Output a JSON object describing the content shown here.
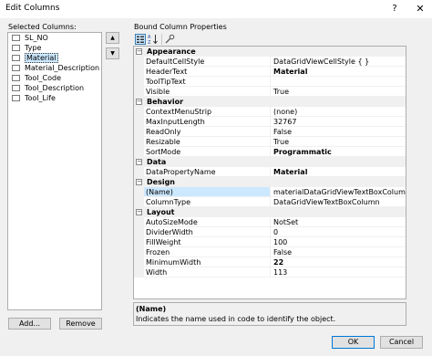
{
  "window": {
    "title": "Edit Columns",
    "help": "?",
    "close": "✕"
  },
  "left": {
    "heading": "Selected Columns:",
    "items": [
      "SL_NO",
      "Type",
      "Material",
      "Material_Description",
      "Tool_Code",
      "Tool_Description",
      "Tool_Life"
    ],
    "selected_index": 2,
    "add_label": "Add...",
    "remove_label": "Remove",
    "move_up": "▲",
    "move_down": "▼"
  },
  "right": {
    "heading": "Bound Column Properties",
    "categories": [
      {
        "name": "Appearance",
        "toggle": "−",
        "props": [
          {
            "name": "DefaultCellStyle",
            "value": "DataGridViewCellStyle { }"
          },
          {
            "name": "HeaderText",
            "value": "Material"
          },
          {
            "name": "ToolTipText",
            "value": ""
          },
          {
            "name": "Visible",
            "value": "True"
          }
        ]
      },
      {
        "name": "Behavior",
        "toggle": "−",
        "props": [
          {
            "name": "ContextMenuStrip",
            "value": "(none)"
          },
          {
            "name": "MaxInputLength",
            "value": "32767"
          },
          {
            "name": "ReadOnly",
            "value": "False"
          },
          {
            "name": "Resizable",
            "value": "True"
          },
          {
            "name": "SortMode",
            "value": "Programmatic"
          }
        ]
      },
      {
        "name": "Data",
        "toggle": "−",
        "props": [
          {
            "name": "DataPropertyName",
            "value": "Material"
          }
        ]
      },
      {
        "name": "Design",
        "toggle": "−",
        "props": [
          {
            "name": "(Name)",
            "value": "materialDataGridViewTextBoxColumn"
          },
          {
            "name": "ColumnType",
            "value": "DataGridViewTextBoxColumn"
          }
        ]
      },
      {
        "name": "Layout",
        "toggle": "−",
        "props": [
          {
            "name": "AutoSizeMode",
            "value": "NotSet"
          },
          {
            "name": "DividerWidth",
            "value": "0"
          },
          {
            "name": "FillWeight",
            "value": "100"
          },
          {
            "name": "Frozen",
            "value": "False"
          },
          {
            "name": "MinimumWidth",
            "value": "22"
          },
          {
            "name": "Width",
            "value": "113"
          }
        ]
      }
    ],
    "description": {
      "title": "(Name)",
      "text": "Indicates the name used in code to identify the object."
    }
  },
  "footer": {
    "ok_label": "OK",
    "cancel_label": "Cancel"
  },
  "colors": {
    "selection": "#cce8ff",
    "dialog_bg": "#f0f0f0",
    "border": "#adadad",
    "ok_border": "#0078d7"
  }
}
